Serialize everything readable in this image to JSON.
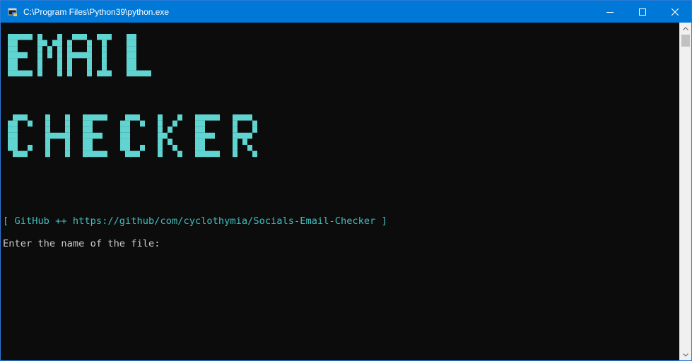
{
  "window": {
    "title": "C:\\Program Files\\Python39\\python.exe",
    "controls": {
      "minimize": "minimize",
      "maximize": "maximize",
      "close": "close"
    },
    "accent_color": "#0078d7"
  },
  "console": {
    "background": "#0c0c0c",
    "banner_lines": [
      "EMAIL",
      "CHECKER"
    ],
    "banner_color": "#5fd4d0",
    "github_line": "[ GitHub ++ https://github/com/cyclothymia/Socials-Email-Checker ]",
    "github_color": "#3fbebe",
    "prompt": "Enter the name of the file:",
    "input_value": ""
  },
  "scrollbar": {
    "up_icon": "arrow-up-icon",
    "down_icon": "arrow-down-icon"
  }
}
